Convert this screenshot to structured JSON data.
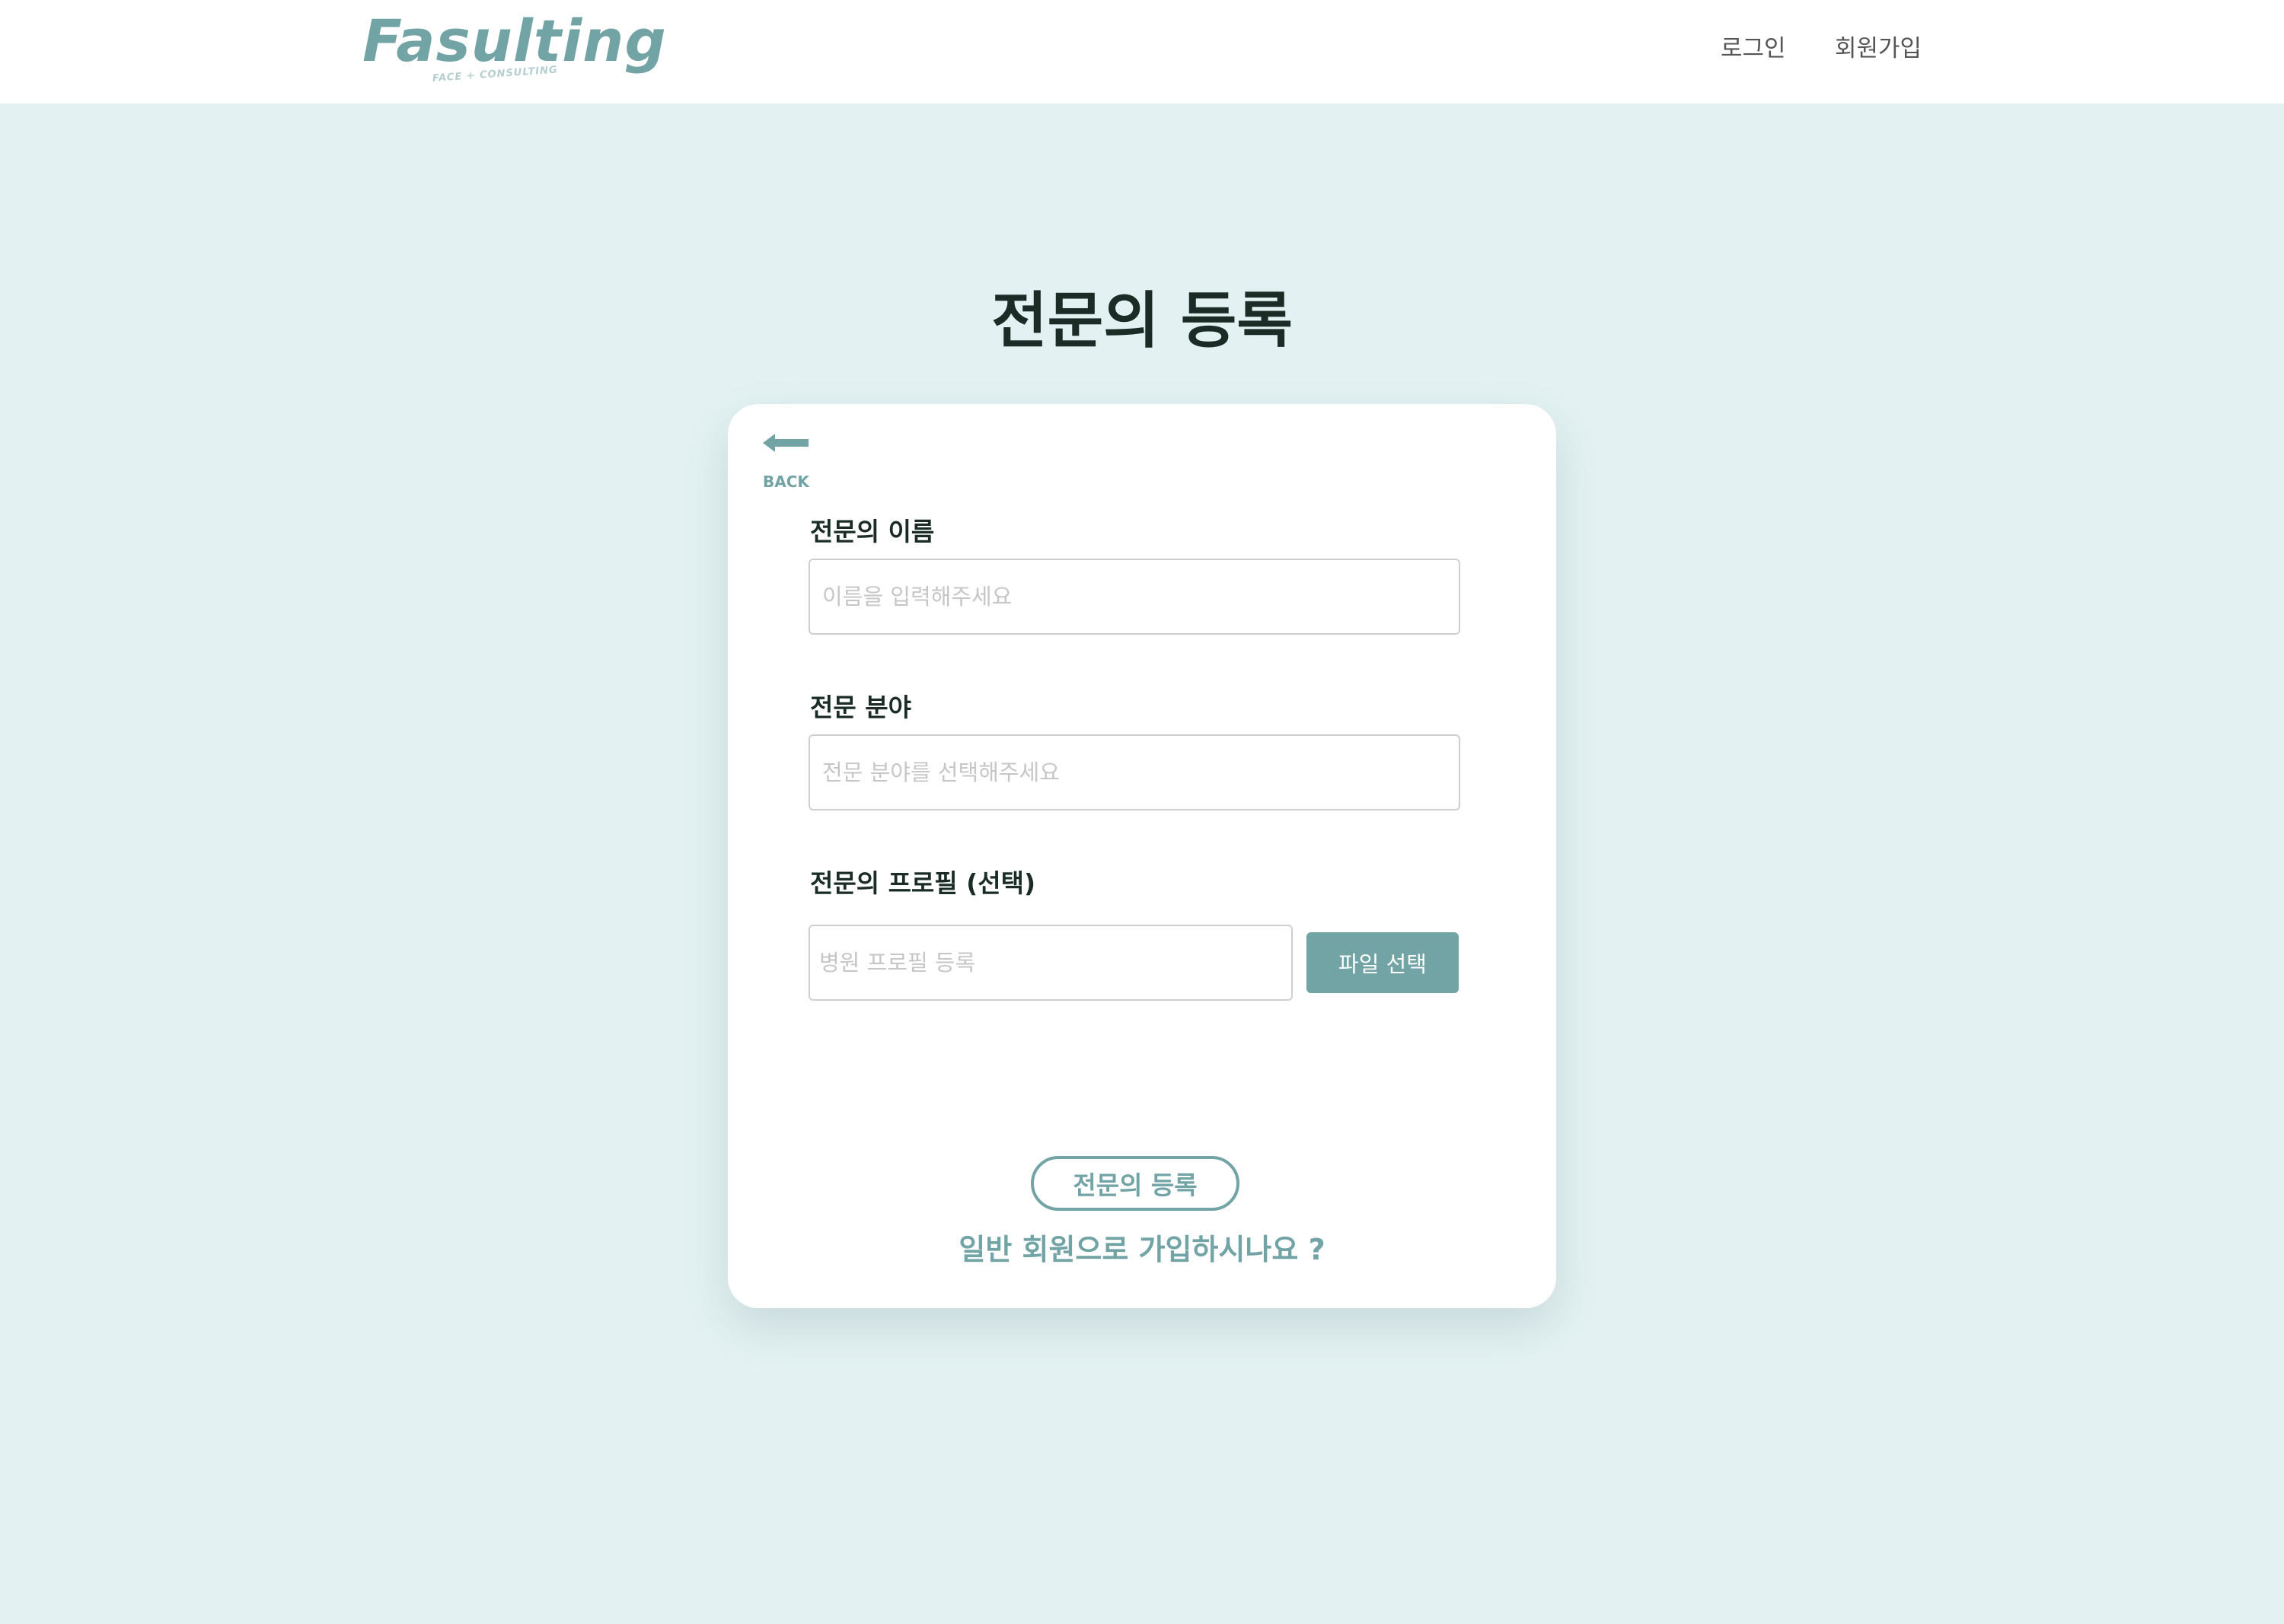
{
  "header": {
    "logo_text": "Fasulting",
    "logo_tagline": "FACE + CONSULTING",
    "nav": {
      "login": "로그인",
      "signup": "회원가입"
    }
  },
  "page": {
    "title": "전문의 등록"
  },
  "form": {
    "back_label": "BACK",
    "name": {
      "label": "전문의 이름",
      "placeholder": "이름을 입력해주세요",
      "value": ""
    },
    "specialty": {
      "label": "전문 분야",
      "placeholder": "전문 분야를 선택해주세요",
      "value": ""
    },
    "profile": {
      "label": "전문의 프로필 (선택)",
      "placeholder": "병원 프로필 등록",
      "value": "",
      "file_button_label": "파일 선택"
    },
    "submit_label": "전문의 등록",
    "general_signup_link": "일반 회원으로 가입하시나요 ?"
  },
  "colors": {
    "accent": "#72a3a5",
    "background": "#e3f1f2",
    "heading": "#1a2c25"
  },
  "icons": {
    "back": "arrow-left-icon"
  }
}
